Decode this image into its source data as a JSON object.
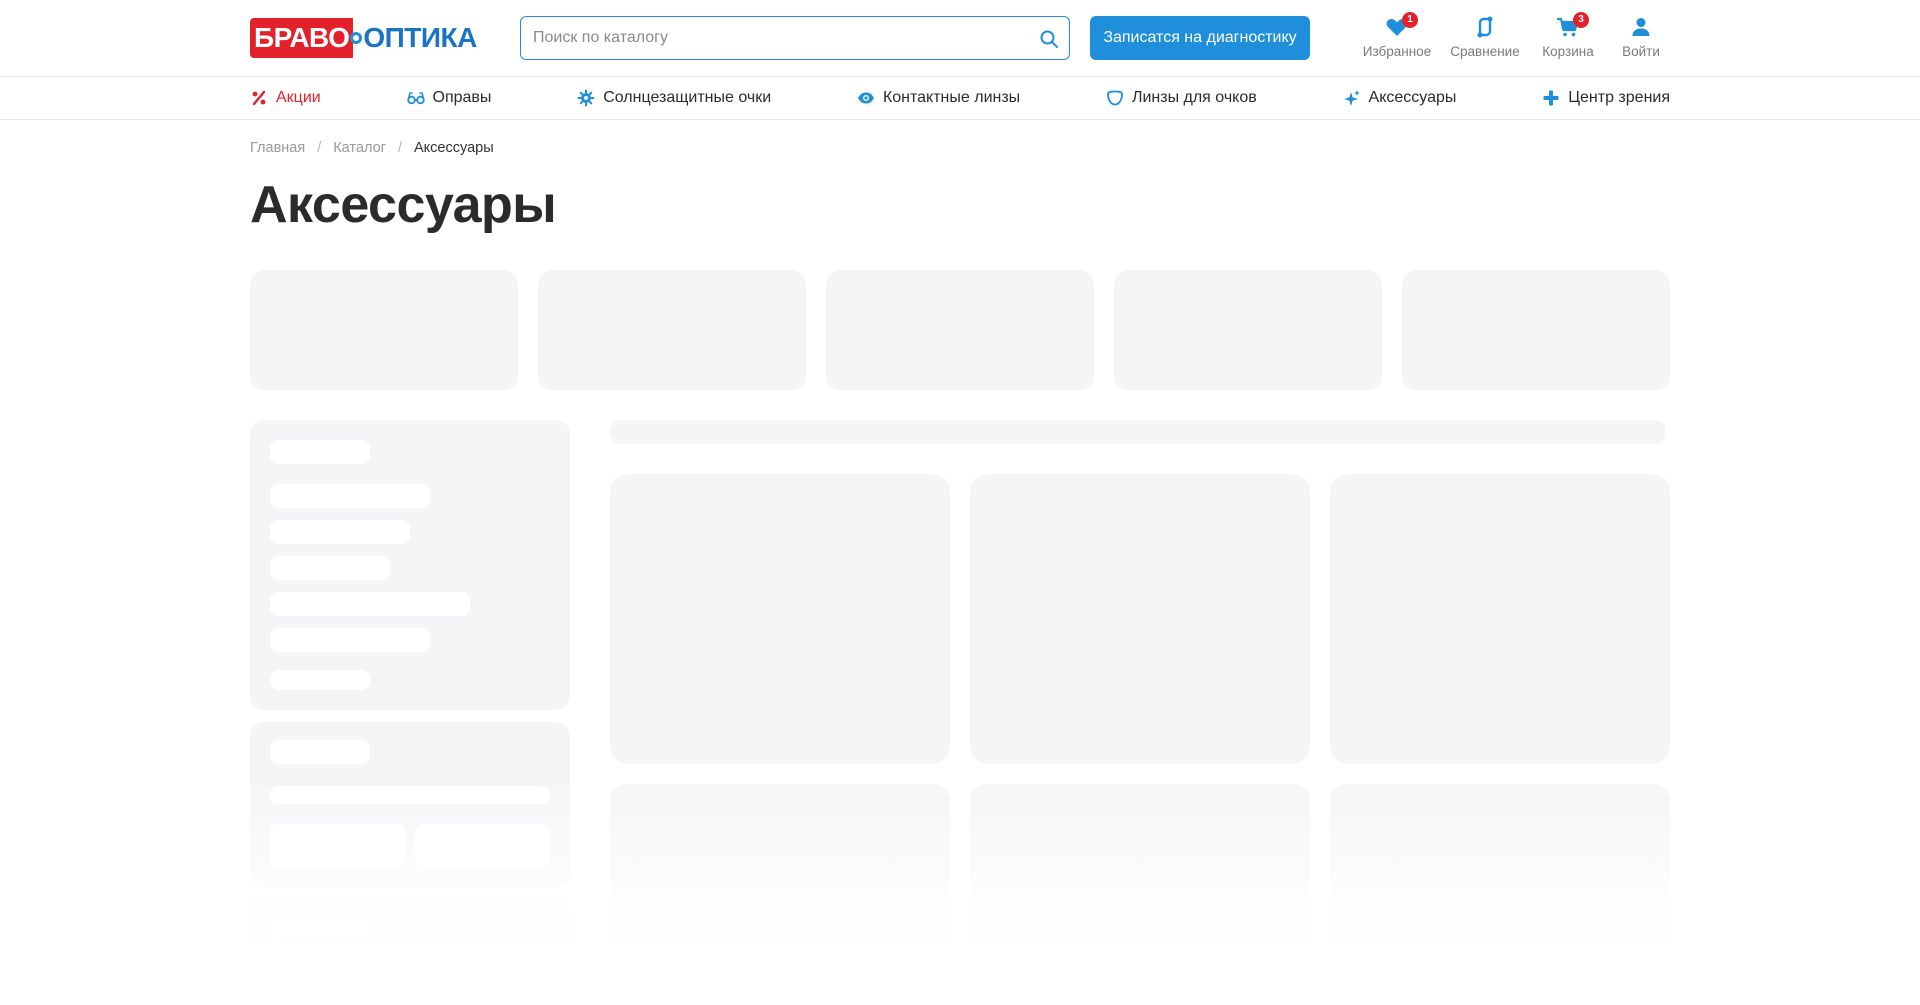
{
  "header": {
    "logo_left": "БРАВО",
    "logo_right": "ОПТИКА",
    "search_placeholder": "Поиск по каталогу",
    "cta_label": "Записатся на диагностику",
    "icons": {
      "favorites": {
        "label": "Избранное",
        "count": "1"
      },
      "compare": {
        "label": "Сравнение"
      },
      "cart": {
        "label": "Корзина",
        "count": "3"
      },
      "login": {
        "label": "Войти"
      }
    }
  },
  "nav": {
    "items": [
      {
        "label": "Акции",
        "icon": "percent-icon"
      },
      {
        "label": "Оправы",
        "icon": "glasses-icon"
      },
      {
        "label": "Солнцезащитные очки",
        "icon": "sun-gear-icon"
      },
      {
        "label": "Контактные линзы",
        "icon": "eye-icon"
      },
      {
        "label": "Линзы для очков",
        "icon": "lens-icon"
      },
      {
        "label": "Аксессуары",
        "icon": "sparkle-icon"
      },
      {
        "label": "Центр зрения",
        "icon": "plus-icon"
      }
    ]
  },
  "breadcrumb": {
    "items": [
      "Главная",
      "Каталог",
      "Аксессуары"
    ],
    "separator": "/"
  },
  "page": {
    "title": "Аксессуары"
  },
  "colors": {
    "accent": "#1f8fdb",
    "brand_red": "#e3212b",
    "skeleton": "#f4f5f7"
  }
}
